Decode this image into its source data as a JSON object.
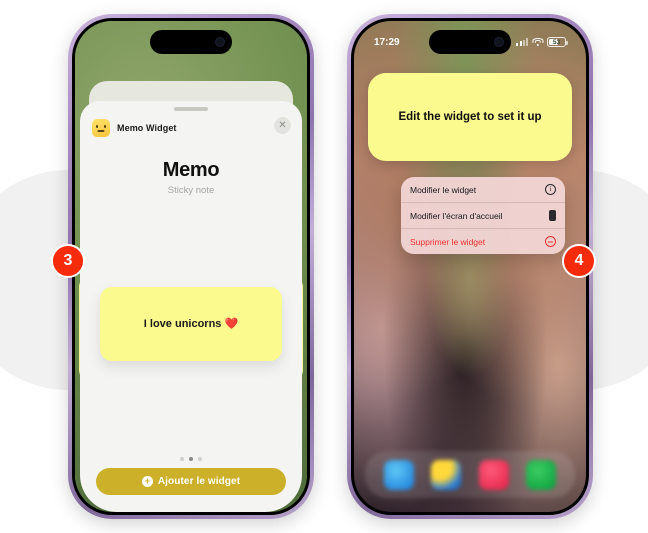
{
  "steps": [
    {
      "number": "3"
    },
    {
      "number": "4"
    }
  ],
  "left_phone": {
    "name": "iphone-add-widget-sheet",
    "sheet": {
      "app_icon": "memo-app-icon",
      "app_name": "Memo Widget",
      "close_icon": "✕",
      "widget_title": "Memo",
      "widget_subtitle": "Sticky note",
      "sticky_note_text": "I love unicorns ❤️",
      "page_dots": {
        "count": 3,
        "active_index": 1
      },
      "cta": {
        "icon": "+",
        "label": "Ajouter le widget"
      }
    }
  },
  "right_phone": {
    "name": "iphone-home-screen-context-menu",
    "status_bar": {
      "time": "17:29",
      "signal_icon": "cellular-bars-icon",
      "wifi_icon": "wifi-icon",
      "battery_level": "53"
    },
    "widget": {
      "text": "Edit the widget to set it up"
    },
    "context_menu": {
      "items": [
        {
          "label": "Modifier le widget",
          "icon": "info-circle-icon",
          "glyph": "i",
          "danger": false
        },
        {
          "label": "Modifier l'écran d'accueil",
          "icon": "device-icon",
          "glyph": "",
          "danger": false
        },
        {
          "label": "Supprimer le widget",
          "icon": "minus-circle-icon",
          "glyph": "",
          "danger": true
        }
      ]
    },
    "dock": {
      "icons": [
        "dock-icon-blue",
        "dock-icon-photos",
        "dock-icon-pink",
        "dock-icon-green"
      ]
    }
  },
  "colors": {
    "badge": "#f62b0b",
    "sticky_yellow": "#fafa8f",
    "cta_gold": "#ccb02a",
    "danger_red": "#ef2f2f",
    "page_background": "#ffffff",
    "decor_circle": "#f1f1f1"
  }
}
